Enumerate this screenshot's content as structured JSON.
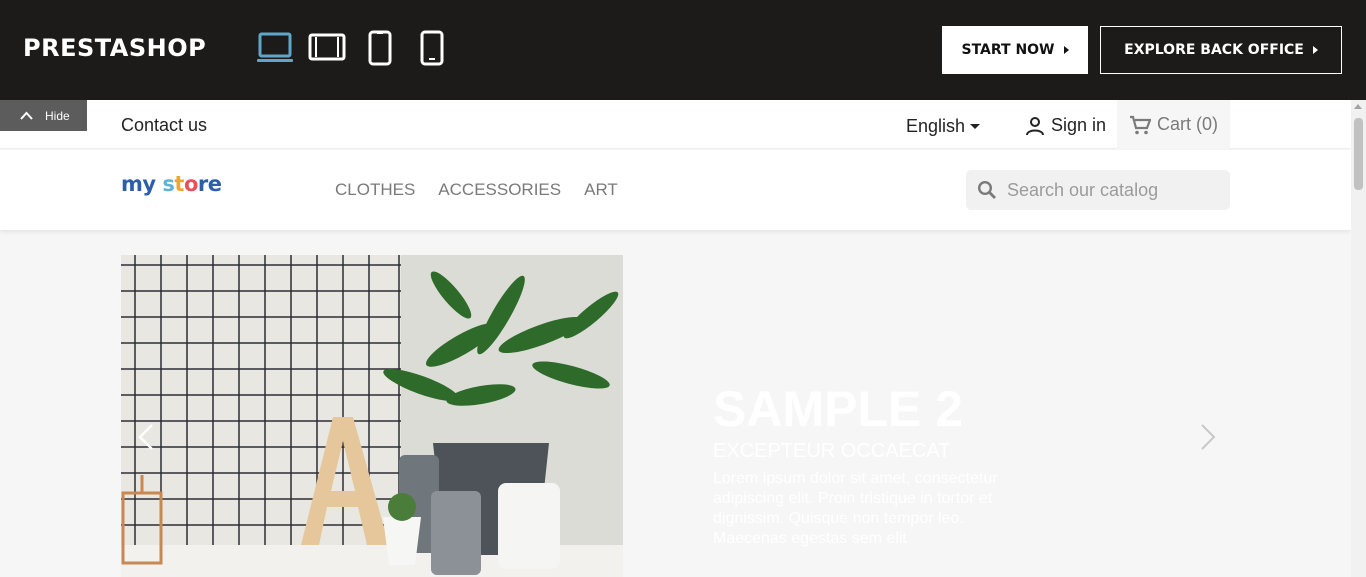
{
  "demo_bar": {
    "brand": "PRESTASHOP",
    "devices": [
      "laptop-icon",
      "tablet-landscape-icon",
      "tablet-portrait-icon",
      "phone-icon"
    ],
    "active_device_color": "#5fa6c9",
    "start_now": "START NOW",
    "explore": "EXPLORE BACK OFFICE",
    "hide": "Hide"
  },
  "store": {
    "contact": "Contact us",
    "language": "English",
    "signin": "Sign in",
    "cart": "Cart (0)",
    "logo": {
      "my": "my",
      "s": "s",
      "t": "t",
      "o": "o",
      "re": "re"
    },
    "menu": [
      "CLOTHES",
      "ACCESSORIES",
      "ART"
    ],
    "search_placeholder": "Search our catalog"
  },
  "slide": {
    "title": "SAMPLE 2",
    "subtitle": "EXCEPTEUR OCCAECAT",
    "body": "Lorem ipsum dolor sit amet, consectetur adipiscing elit. Proin tristique in tortor et dignissim. Quisque non tempor leo. Maecenas egestas sem elit"
  }
}
